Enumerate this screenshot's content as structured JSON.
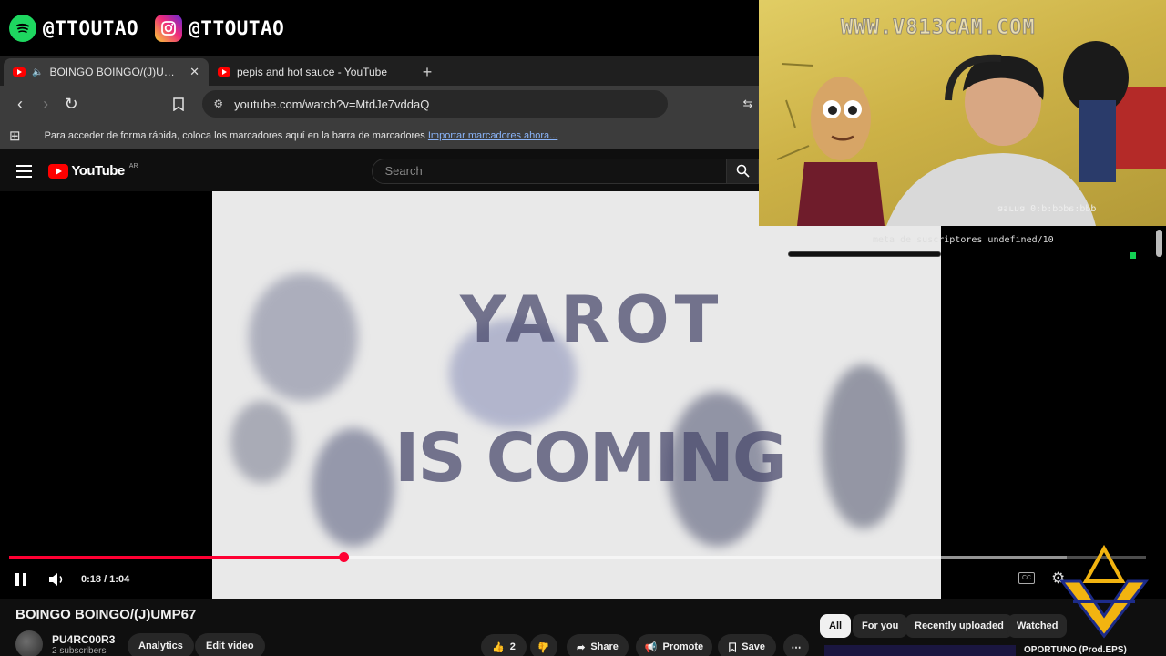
{
  "overlay": {
    "spotify_handle": "@TTOUTAO",
    "instagram_handle": "@TTOUTAO",
    "webcam_watermark": "WWW.V813CAM.COM",
    "webcam_mirrored_text": "ddd:adod:d:0 ɐuɹsɐ",
    "subscriber_goal": "meta de suscriptores undefined/10"
  },
  "browser": {
    "tabs": [
      {
        "title": "BOINGO BOINGO/(J)UMP67",
        "active": true
      },
      {
        "title": "pepis and hot sauce - YouTube",
        "active": false
      }
    ],
    "url": "youtube.com/watch?v=MtdJe7vddaQ",
    "bookmarks_hint": "Para acceder de forma rápida, coloca los marcadores aquí en la barra de marcadores",
    "bookmarks_import": "Importar marcadores ahora..."
  },
  "youtube": {
    "logo_text": "YouTube",
    "logo_region": "AR",
    "search_placeholder": "Search"
  },
  "player": {
    "video_text_line1": "YAROT",
    "video_text_line2": "IS COMING",
    "timecode": "0:18 / 1:04",
    "progress": 0.294,
    "loaded": 0.93
  },
  "video": {
    "title": "BOINGO BOINGO/(J)UMP67",
    "channel_name": "PU4RC00R3",
    "subscribers": "2 subscribers",
    "analytics_label": "Analytics",
    "edit_label": "Edit video",
    "likes": "2",
    "share_label": "Share",
    "promote_label": "Promote",
    "save_label": "Save"
  },
  "recommendations": {
    "chips": [
      "All",
      "For you",
      "Recently uploaded",
      "Watched"
    ],
    "first_title": "OPORTUNO (Prod.EPS)"
  },
  "colors": {
    "youtube_red": "#ff0000",
    "progress_red": "#ff0033",
    "spotify_green": "#1ed760",
    "goal_green": "#13d154"
  }
}
